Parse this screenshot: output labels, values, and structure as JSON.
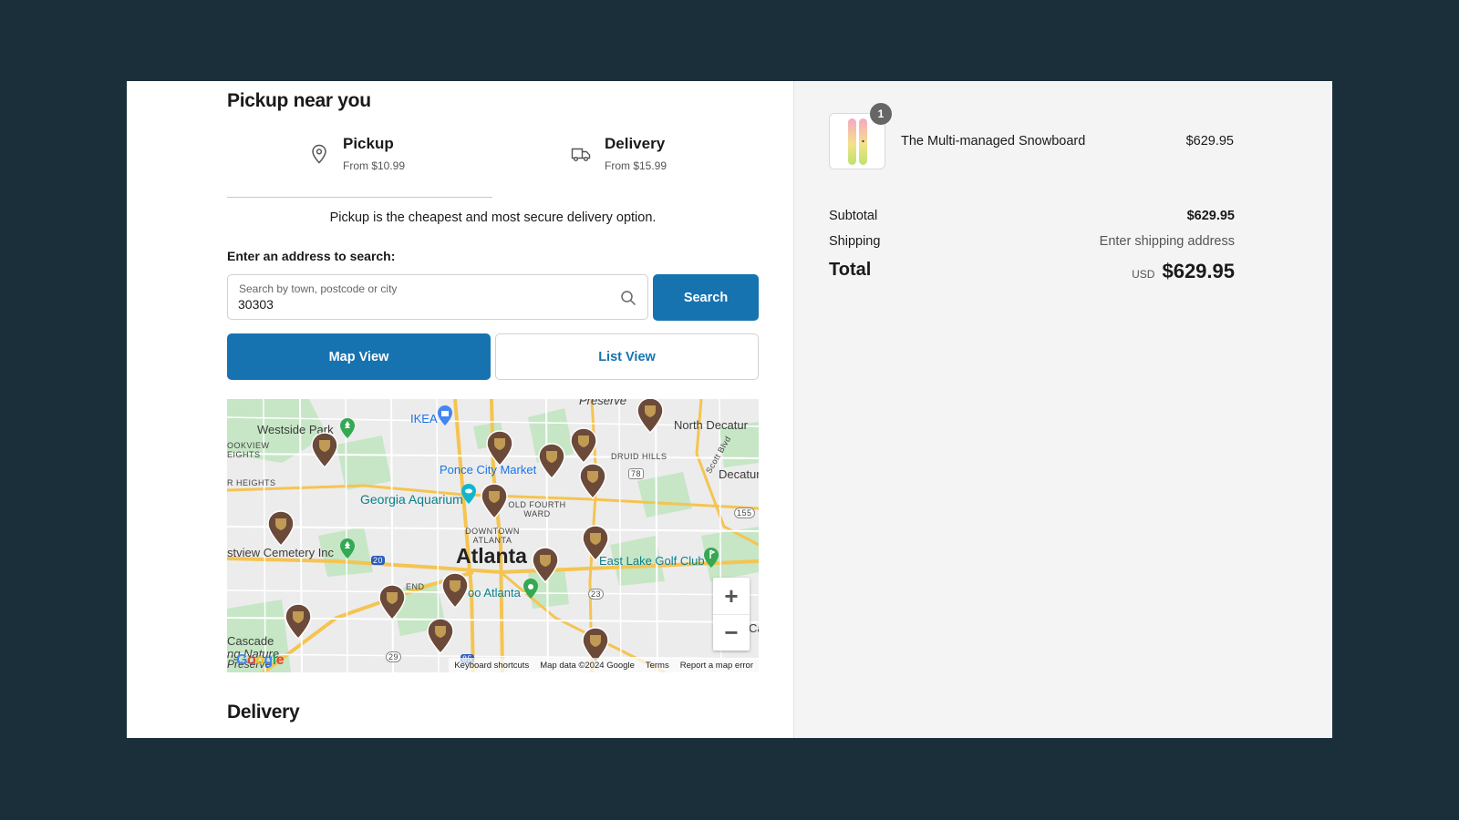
{
  "pickup": {
    "heading": "Pickup near you",
    "tabs": [
      {
        "title": "Pickup",
        "subtitle": "From $10.99",
        "icon": "location-pin-icon"
      },
      {
        "title": "Delivery",
        "subtitle": "From $15.99",
        "icon": "truck-icon"
      }
    ],
    "tagline": "Pickup is the cheapest and most secure delivery option.",
    "address_label": "Enter an address to search:",
    "search": {
      "placeholder": "Search by town, postcode or city",
      "value": "30303",
      "button": "Search"
    },
    "views": {
      "map": "Map View",
      "list": "List View"
    }
  },
  "map": {
    "labels": {
      "atlanta": "Atlanta",
      "westside_park": "Westside Park",
      "ikea": "IKEA",
      "north_decatur": "North Decatur",
      "decatur": "Decatur",
      "druid_hills": "DRUID HILLS",
      "ponce": "Ponce City Market",
      "aquarium": "Georgia Aquarium",
      "old_fourth_ward": "OLD FOURTH WARD",
      "downtown": "DOWNTOWN ATLANTA",
      "cemetery": "stview Cemetery Inc",
      "east_lake": "East Lake Golf Club",
      "zoo": "oo Atlanta",
      "cascade": "Cascade",
      "preserve": "Preserve",
      "scott_blvd": "Scott Blvd",
      "bookview": "OOKVIEW EIGHTS",
      "heights": "R HEIGHTS",
      "town": "WN",
      "end": "END",
      "ca": "Ca",
      "nature": "ng Nature",
      "preserve2": "Preserve",
      "hwy78": "78",
      "hwy155": "155",
      "hwy20": "20",
      "hwy23": "23",
      "hwy29": "29",
      "hwy85": "85"
    },
    "pin_label": "ups",
    "pin_color": "#6b4a3a",
    "zoom_in": "+",
    "zoom_out": "−",
    "google": "Google",
    "attribution": [
      "Keyboard shortcuts",
      "Map data ©2024 Google",
      "Terms",
      "Report a map error"
    ]
  },
  "delivery_heading": "Delivery",
  "summary": {
    "product": {
      "name": "The Multi-managed Snowboard",
      "price": "$629.95",
      "quantity": "1"
    },
    "subtotal_label": "Subtotal",
    "subtotal": "$629.95",
    "shipping_label": "Shipping",
    "shipping": "Enter shipping address",
    "total_label": "Total",
    "currency": "USD",
    "total": "$629.95"
  },
  "colors": {
    "accent": "#1773b0",
    "background": "#1b2f3b",
    "summary_bg": "#f4f4f4"
  }
}
